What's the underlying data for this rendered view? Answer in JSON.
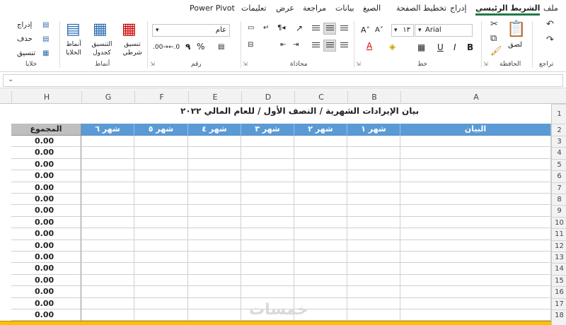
{
  "menu": {
    "items": [
      "ملف",
      "الشريط الرئيسي",
      "إدراج",
      "تخطيط الصفحة",
      "الصيغ",
      "بيانات",
      "مراجعة",
      "عرض",
      "تعليمات",
      "Power Pivot"
    ],
    "active": "الشريط الرئيسي"
  },
  "ribbon": {
    "undo_group": "تراجع",
    "clipboard": {
      "label": "الحافظة",
      "paste": "لصق"
    },
    "font": {
      "label": "خط",
      "name": "Arial",
      "size": "١٣"
    },
    "alignment": {
      "label": "محاذاة"
    },
    "number": {
      "label": "رقم",
      "format": "عام",
      "comma": "٩",
      "percent": "%"
    },
    "styles": {
      "label": "أنماط",
      "conditional": "تنسيق شرطي",
      "table": "التنسيق كجدول",
      "cell": "أنماط الخلايا"
    },
    "cells": {
      "label": "خلايا",
      "insert": "إدراج",
      "delete": "حذف",
      "format": "تنسيق"
    }
  },
  "grid": {
    "columns": [
      "A",
      "B",
      "C",
      "D",
      "E",
      "F",
      "G",
      "H"
    ],
    "rows": [
      "1",
      "2",
      "3",
      "4",
      "5",
      "6",
      "7",
      "8",
      "9",
      "10",
      "11",
      "12",
      "13",
      "14",
      "15",
      "16",
      "17",
      "18"
    ],
    "title": "بيان الإيرادات الشهرية / النصف الأول / للعام المالي ٢٠٢٢",
    "headers": {
      "statement": "البيان",
      "months": [
        "شهر ١",
        "شهر ٢",
        "شهر ٣",
        "شهر ٤",
        "شهر ٥",
        "شهر ٦"
      ],
      "total": "المجموع"
    },
    "totals": [
      "0.00",
      "0.00",
      "0.00",
      "0.00",
      "0.00",
      "0.00",
      "0.00",
      "0.00",
      "0.00",
      "0.00",
      "0.00",
      "0.00",
      "0.00",
      "0.00",
      "0.00",
      "0.00"
    ],
    "watermark": "خمسات"
  },
  "colors": {
    "header_blue": "#5b9bd5",
    "total_gray": "#bfbfbf",
    "total_row": "#ffc000",
    "accent": "#1e7b45"
  }
}
